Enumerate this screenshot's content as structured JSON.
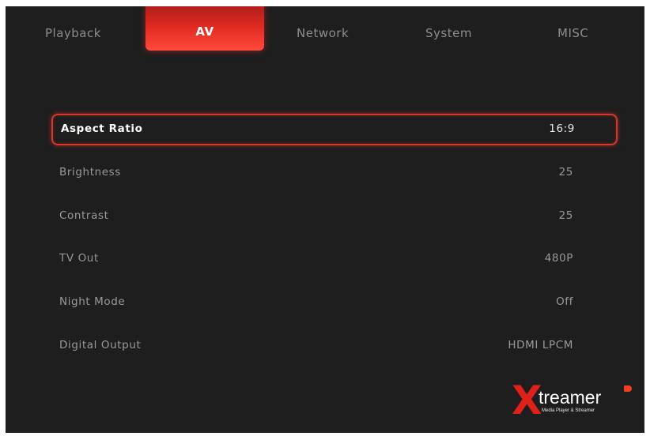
{
  "tabs": [
    {
      "label": "Playback",
      "active": false
    },
    {
      "label": "AV",
      "active": true
    },
    {
      "label": "Network",
      "active": false
    },
    {
      "label": "System",
      "active": false
    },
    {
      "label": "MISC",
      "active": false
    }
  ],
  "settings": [
    {
      "label": "Aspect Ratio",
      "value": "16:9",
      "selected": true
    },
    {
      "label": "Brightness",
      "value": "25",
      "selected": false
    },
    {
      "label": "Contrast",
      "value": "25",
      "selected": false
    },
    {
      "label": "TV Out",
      "value": "480P",
      "selected": false
    },
    {
      "label": "Night Mode",
      "value": "Off",
      "selected": false
    },
    {
      "label": "Digital Output",
      "value": "HDMI LPCM",
      "selected": false
    }
  ],
  "logo": {
    "x_letter": "X",
    "word": "treamer",
    "tagline": "Media Player & Streamer"
  },
  "colors": {
    "background": "#1e1e1e",
    "accent": "#e02a22",
    "text_dim": "#9a9a9a",
    "text_bright": "#ffffff"
  }
}
